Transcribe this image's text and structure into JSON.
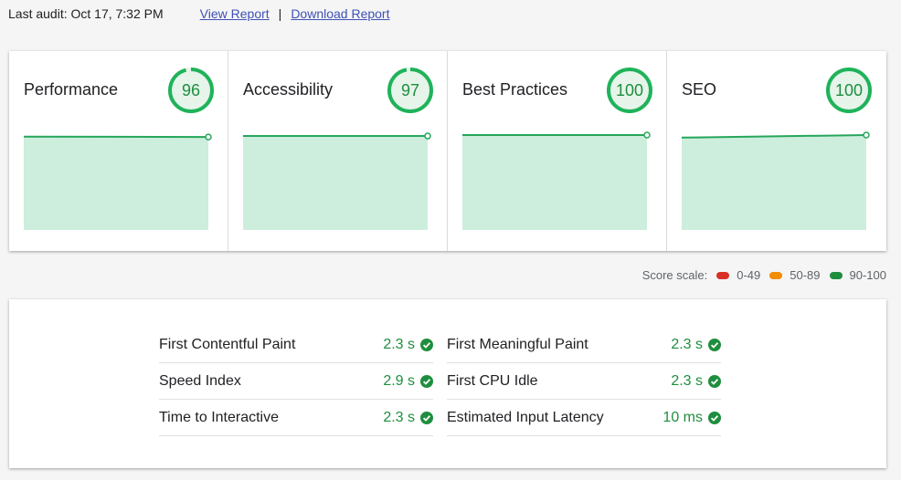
{
  "header": {
    "last_audit": "Last audit: Oct 17, 7:32 PM",
    "view_report": "View Report",
    "separator": "|",
    "download_report": "Download Report"
  },
  "colors": {
    "good": "#1e8e3e",
    "good_fill": "#cdeedc",
    "good_line": "#26a65b",
    "average": "#f28c00",
    "poor": "#d93025"
  },
  "categories": [
    {
      "title": "Performance",
      "score": "96",
      "score_value": 96,
      "trend": [
        95,
        94
      ]
    },
    {
      "title": "Accessibility",
      "score": "97",
      "score_value": 97,
      "trend": [
        97,
        97
      ]
    },
    {
      "title": "Best Practices",
      "score": "100",
      "score_value": 100,
      "trend": [
        100,
        100
      ]
    },
    {
      "title": "SEO",
      "score": "100",
      "score_value": 100,
      "trend": [
        92,
        100
      ]
    }
  ],
  "scale": {
    "label": "Score scale:",
    "ranges": [
      {
        "label": "0-49",
        "color": "#d93025"
      },
      {
        "label": "50-89",
        "color": "#f28c00"
      },
      {
        "label": "90-100",
        "color": "#1e8e3e"
      }
    ]
  },
  "metrics": {
    "left": [
      {
        "name": "First Contentful Paint",
        "value": "2.3 s"
      },
      {
        "name": "Speed Index",
        "value": "2.9 s"
      },
      {
        "name": "Time to Interactive",
        "value": "2.3 s"
      }
    ],
    "right": [
      {
        "name": "First Meaningful Paint",
        "value": "2.3 s"
      },
      {
        "name": "First CPU Idle",
        "value": "2.3 s"
      },
      {
        "name": "Estimated Input Latency",
        "value": "10 ms"
      }
    ]
  }
}
